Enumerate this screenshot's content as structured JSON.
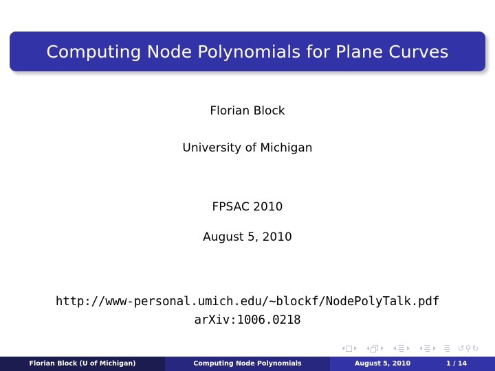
{
  "slide": {
    "title": "Computing Node Polynomials for Plane Curves",
    "author": "Florian Block",
    "affiliation": "University of Michigan",
    "conference": "FPSAC 2010",
    "date": "August 5, 2010",
    "url": "http://www-personal.umich.edu/∼blockf/NodePolyTalk.pdf",
    "arxiv": "arXiv:1006.0218"
  },
  "colors": {
    "title_bar": "#3333a8",
    "title_text": "#ffffff",
    "footer_left": "#1c1c50",
    "footer_middle": "#27277f",
    "footer_right": "#3333a8",
    "background": "#ffffff",
    "nav_symbol": "#8c8cd4"
  },
  "nav_symbols": {
    "slide_icon": "slide-navigation-icon",
    "frame_icon": "frame-navigation-icon",
    "subsection_icon": "subsection-navigation-icon",
    "section_icon": "section-navigation-icon",
    "presentation_icon": "presentation-navigation-icon",
    "back_glyph": "↺",
    "search_glyph": "⚲",
    "forward_glyph": "↻"
  },
  "footer": {
    "author": "Florian Block  (U of Michigan)",
    "short_title": "Computing Node Polynomials",
    "date": "August 5, 2010",
    "page": "1 / 14"
  }
}
